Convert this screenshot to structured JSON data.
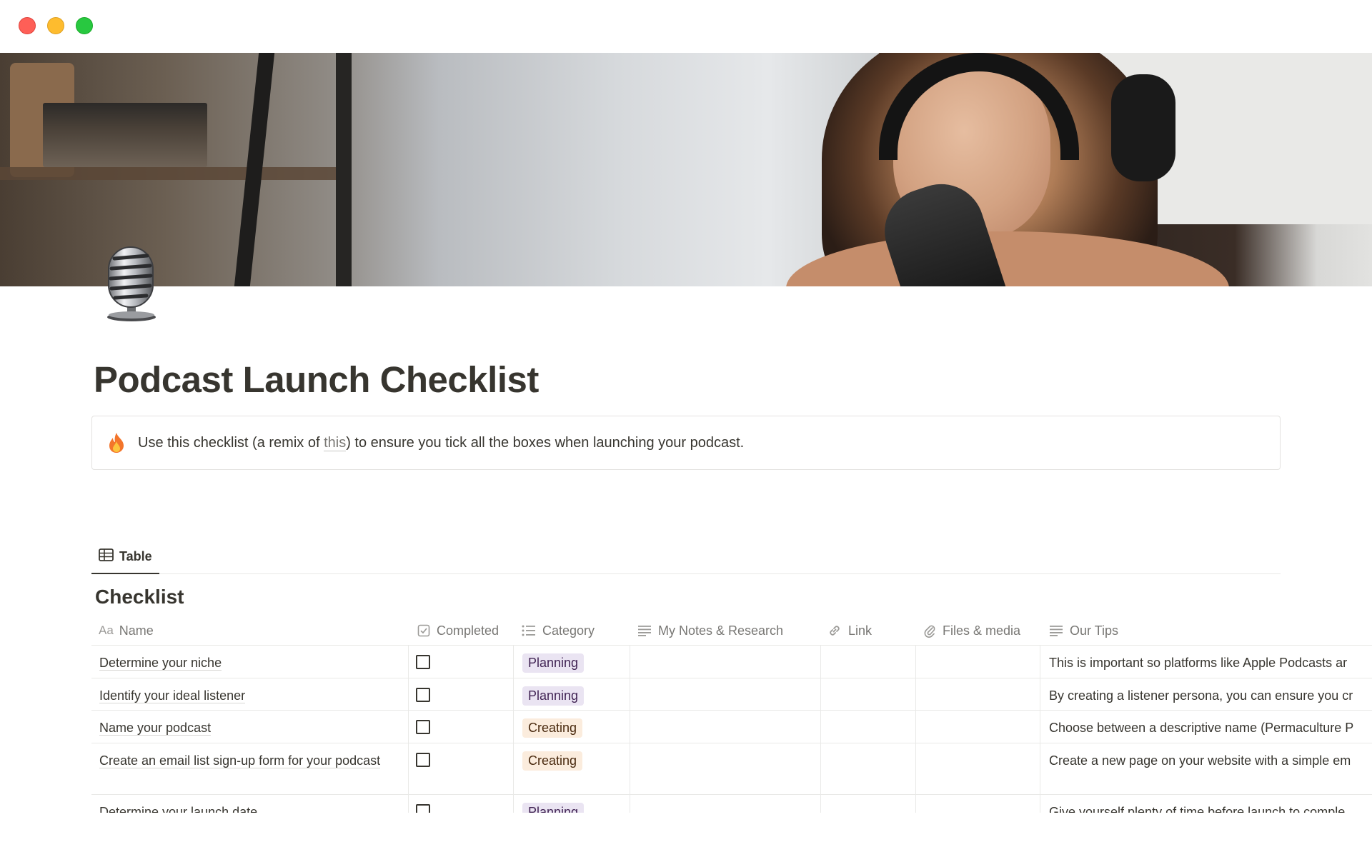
{
  "window": {
    "controls": [
      "close",
      "minimize",
      "zoom"
    ]
  },
  "cover": {
    "image": "cover-photo"
  },
  "page": {
    "icon": "microphone-icon",
    "title": "Podcast Launch Checklist"
  },
  "callout": {
    "icon": "fire-icon",
    "text_before": "Use this checklist (a remix of ",
    "link_text": "this",
    "text_after": ") to ensure you tick all the boxes when launching your podcast."
  },
  "views": {
    "tabs": [
      {
        "label": "Table",
        "icon": "table-icon",
        "active": true
      }
    ]
  },
  "database": {
    "title": "Checklist",
    "columns": [
      {
        "label": "Name",
        "icon": "text-type-icon",
        "icon_text": "Aa"
      },
      {
        "label": "Completed",
        "icon": "checkbox-property-icon"
      },
      {
        "label": "Category",
        "icon": "list-icon"
      },
      {
        "label": "My Notes & Research",
        "icon": "text-lines-icon"
      },
      {
        "label": "Link",
        "icon": "link-icon"
      },
      {
        "label": "Files & media",
        "icon": "paperclip-icon"
      },
      {
        "label": "Our Tips",
        "icon": "text-lines-icon"
      }
    ],
    "rows": [
      {
        "name": "Determine your niche",
        "completed": false,
        "category": "Planning",
        "notes": "",
        "link": "",
        "files": "",
        "tips": "This is important so platforms like Apple Podcasts ar"
      },
      {
        "name": "Identify your ideal listener",
        "completed": false,
        "category": "Planning",
        "notes": "",
        "link": "",
        "files": "",
        "tips": "By creating a listener persona, you can ensure you cr"
      },
      {
        "name": "Name your podcast",
        "completed": false,
        "category": "Creating",
        "notes": "",
        "link": "",
        "files": "",
        "tips": "Choose between a descriptive name (Permaculture P"
      },
      {
        "name": "Create an email list sign-up form for your podcast",
        "completed": false,
        "category": "Creating",
        "notes": "",
        "link": "",
        "files": "",
        "tips": "Create a new page on your website with a simple em"
      },
      {
        "name": "Determine your launch date",
        "completed": false,
        "category": "Planning",
        "notes": "",
        "link": "",
        "files": "",
        "tips": "Give yourself plenty of time before launch to comple"
      }
    ]
  },
  "colors": {
    "text": "#37352f",
    "muted": "#787774",
    "border": "#e9e9e7",
    "tag_planning_bg": "#eae4f2",
    "tag_creating_bg": "#fbecdd"
  }
}
